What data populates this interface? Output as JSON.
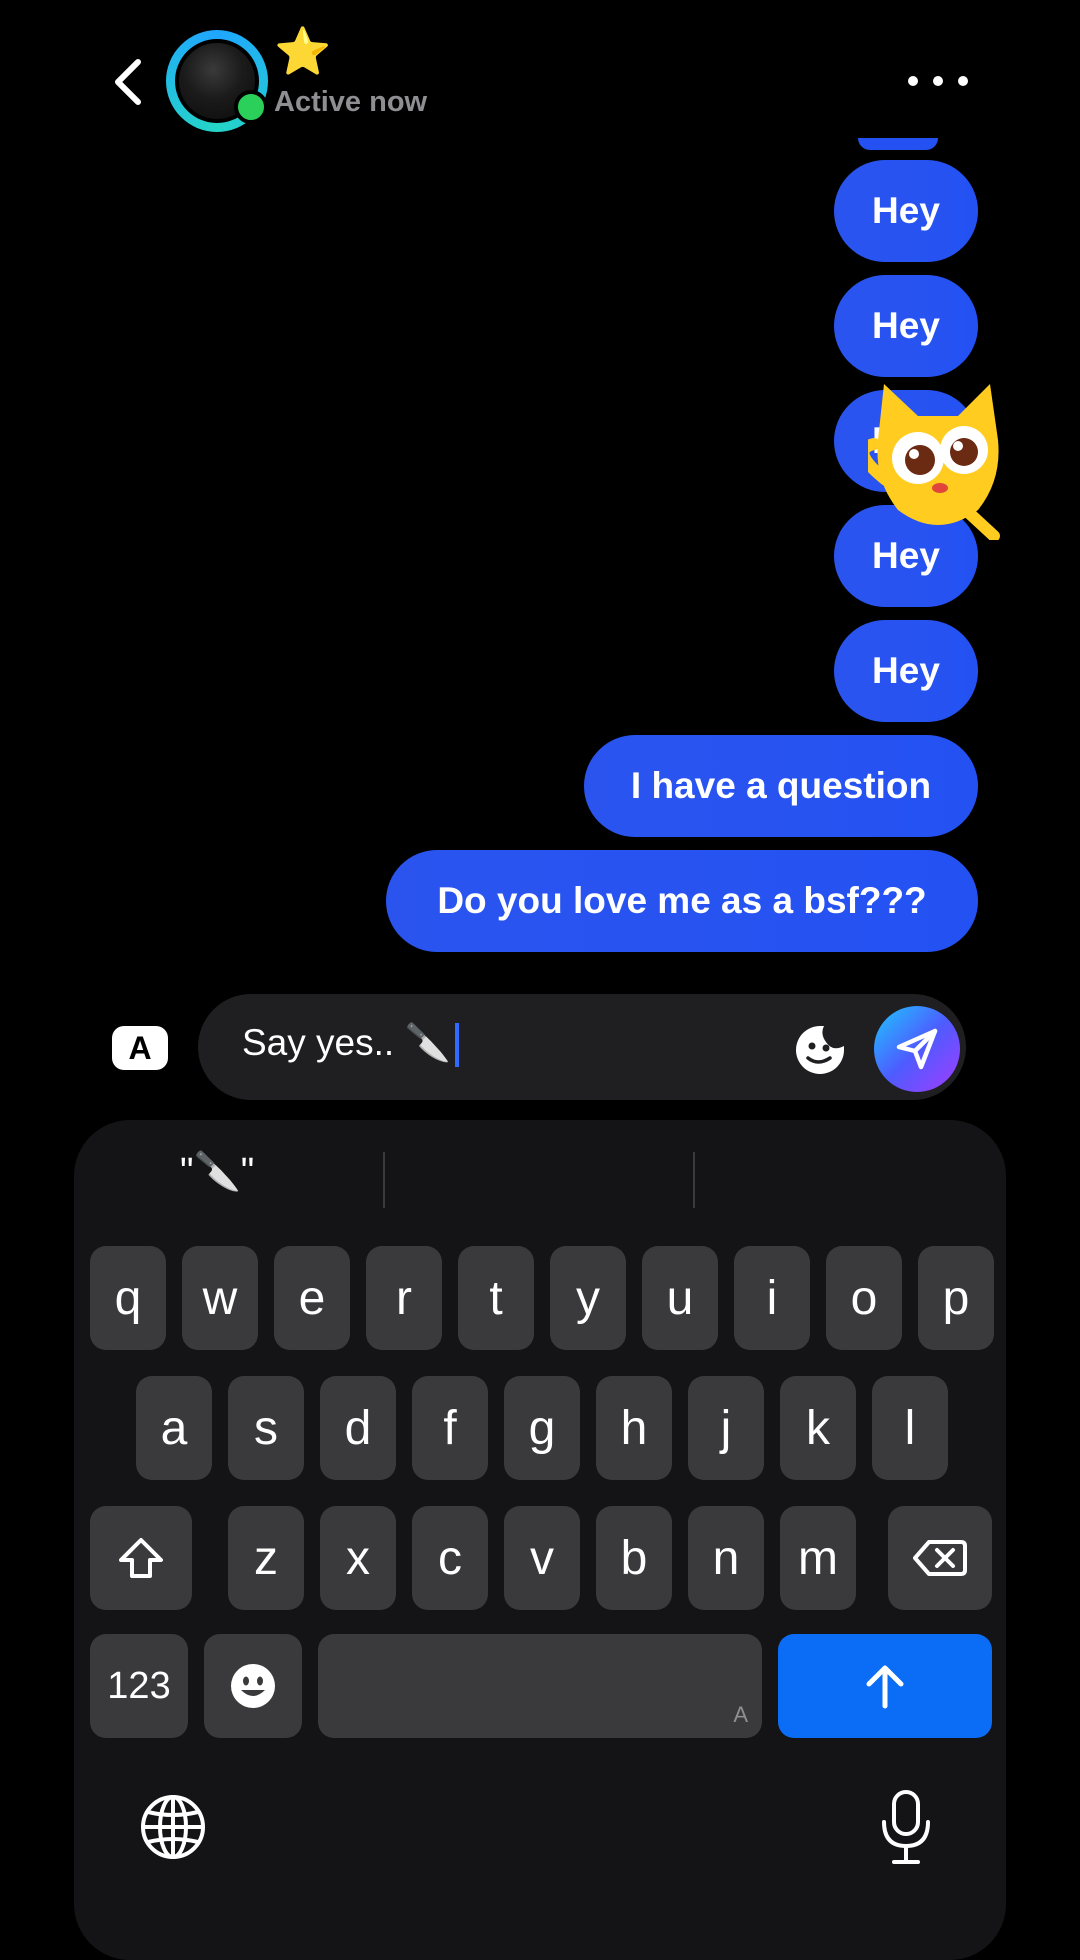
{
  "header": {
    "status": "Active now",
    "star": "⭐"
  },
  "messages": [
    "Hey",
    "Hey",
    "Hey",
    "Hey",
    "Hey",
    "I have a question",
    "Do you love me as a bsf???"
  ],
  "composer": {
    "aa_label": "A",
    "text": "Say yes.. 🔪"
  },
  "keyboard": {
    "suggestion": "\"🔪\"",
    "row1": [
      "q",
      "w",
      "e",
      "r",
      "t",
      "y",
      "u",
      "i",
      "o",
      "p"
    ],
    "row2": [
      "a",
      "s",
      "d",
      "f",
      "g",
      "h",
      "j",
      "k",
      "l"
    ],
    "row3": [
      "z",
      "x",
      "c",
      "v",
      "b",
      "n",
      "m"
    ],
    "numbers_label": "123",
    "space_mark": "A"
  },
  "colors": {
    "bubble": "#2452f2",
    "online": "#2ad05a",
    "return_key": "#0b6cf5"
  }
}
